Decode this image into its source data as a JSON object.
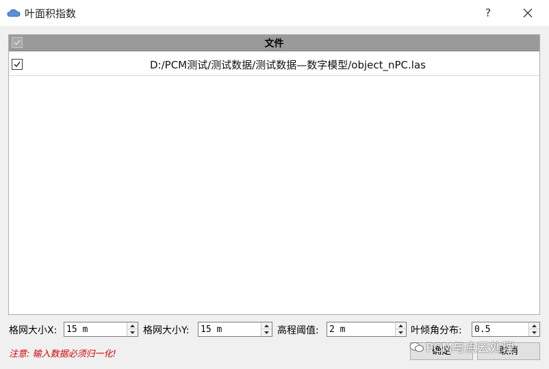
{
  "window": {
    "title": "叶面积指数",
    "help_glyph": "?",
    "icons": {
      "app": "cloud-icon",
      "help": "help-icon",
      "close": "close-icon"
    }
  },
  "table": {
    "header": {
      "label": "文件",
      "checked": true
    },
    "rows": [
      {
        "checked": true,
        "path": "D:/PCM测试/测试数据/测试数据—数字模型/object_nPC.las"
      }
    ]
  },
  "params": {
    "grid_x": {
      "label": "格网大小X:",
      "value": "15 m"
    },
    "grid_y": {
      "label": "格网大小Y:",
      "value": "15 m"
    },
    "height_threshold": {
      "label": "高程阈值:",
      "value": "2 m"
    },
    "leaf_angle": {
      "label": "叶倾角分布:",
      "value": "0.5"
    }
  },
  "note": "注意: 输入数据必须归一化!",
  "buttons": {
    "ok": "确定",
    "cancel": "取消"
  },
  "watermark": "PCM与点云处理",
  "colors": {
    "header_bg": "#9a9a9a",
    "note_text": "#d40000",
    "button_bg": "#e1e1e1",
    "window_bg": "#f0f0f0"
  }
}
